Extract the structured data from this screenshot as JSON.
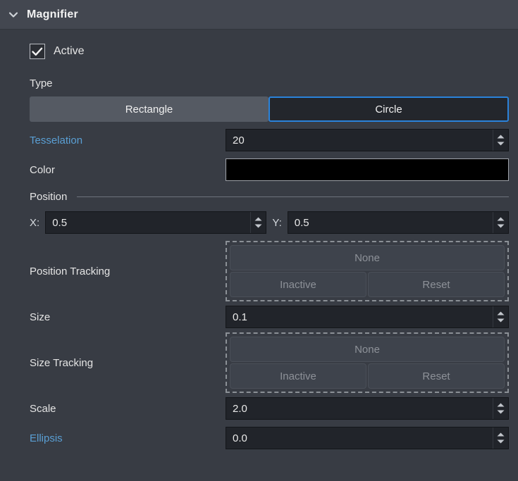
{
  "header": {
    "title": "Magnifier",
    "collapse_icon": "chevron-down-icon",
    "expanded": true
  },
  "active": {
    "label": "Active",
    "checked": true,
    "check_icon": "checkmark-icon"
  },
  "type_section": {
    "label": "Type",
    "options": [
      "Rectangle",
      "Circle"
    ],
    "rectangle_label": "Rectangle",
    "circle_label": "Circle",
    "selected": "Circle"
  },
  "tesselation": {
    "label": "Tesselation",
    "value": "20",
    "accent": true
  },
  "color": {
    "label": "Color",
    "value": "#000000"
  },
  "position_section": {
    "label": "Position",
    "x_label": "X:",
    "x_value": "0.5",
    "y_label": "Y:",
    "y_value": "0.5"
  },
  "position_tracking": {
    "label": "Position Tracking",
    "mode_label": "None",
    "state_label": "Inactive",
    "reset_label": "Reset"
  },
  "size": {
    "label": "Size",
    "value": "0.1"
  },
  "size_tracking": {
    "label": "Size Tracking",
    "mode_label": "None",
    "state_label": "Inactive",
    "reset_label": "Reset"
  },
  "scale": {
    "label": "Scale",
    "value": "2.0"
  },
  "ellipsis": {
    "label": "Ellipsis",
    "value": "0.0",
    "accent": true
  },
  "theme": {
    "accent_blue": "#5a9fd4",
    "selection_blue": "#2a82da",
    "panel_bg": "#383c44",
    "header_bg": "#434750",
    "field_bg": "#21242a",
    "button_bg": "#555a63",
    "disabled_text": "#8d9198"
  }
}
